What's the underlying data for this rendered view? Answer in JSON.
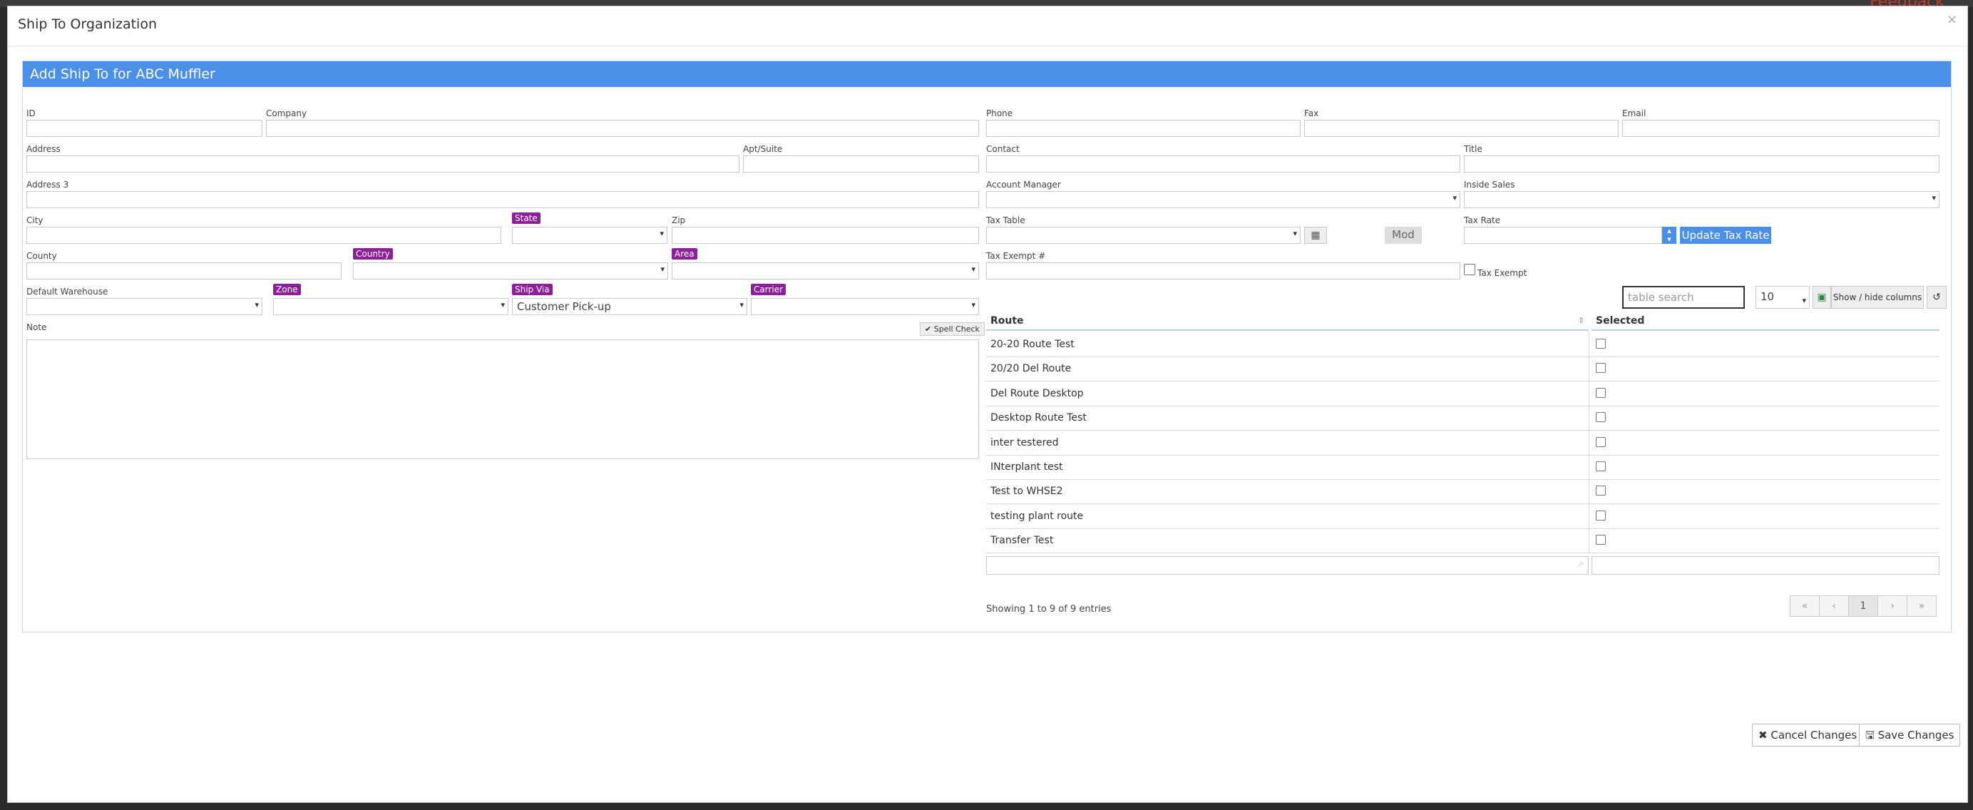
{
  "modal": {
    "title": "Ship To Organization"
  },
  "panel": {
    "heading": "Add Ship To for ABC Muffler"
  },
  "fields": {
    "id": "ID",
    "company": "Company",
    "phone": "Phone",
    "fax": "Fax",
    "email": "Email",
    "address": "Address",
    "apt_suite": "Apt/Suite",
    "contact": "Contact",
    "title": "Title",
    "address3": "Address 3",
    "account_manager": "Account Manager",
    "inside_sales": "Inside Sales",
    "city": "City",
    "state": "State",
    "zip": "Zip",
    "tax_table": "Tax Table",
    "tax_rate": "Tax Rate",
    "county": "County",
    "country": "Country",
    "area": "Area",
    "tax_exempt_num": "Tax Exempt #",
    "tax_exempt": "Tax Exempt",
    "default_warehouse": "Default Warehouse",
    "zone": "Zone",
    "ship_via": "Ship Via",
    "carrier": "Carrier",
    "ship_via_value": "Customer Pick-up",
    "note": "Note"
  },
  "buttons": {
    "spell_check": "Spell Check",
    "mod": "Mod",
    "update_tax_rate": "Update Tax Rate",
    "show_hide": "Show / hide columns",
    "cancel": "Cancel Changes",
    "save": "Save Changes"
  },
  "table": {
    "search_placeholder": "table search",
    "page_size": "10",
    "columns": [
      "Route",
      "Selected"
    ],
    "rows": [
      "20-20 Route Test",
      "20/20 Del Route",
      "Del Route Desktop",
      "Desktop Route Test",
      "inter testered",
      "INterplant test",
      "Test to WHSE2",
      "testing plant route",
      "Transfer Test"
    ],
    "info": "Showing 1 to 9 of 9 entries",
    "pager": {
      "first": "«",
      "prev": "‹",
      "page": "1",
      "next": "›",
      "last": "»"
    }
  },
  "backdrop": {
    "feedback": "Feedback"
  }
}
